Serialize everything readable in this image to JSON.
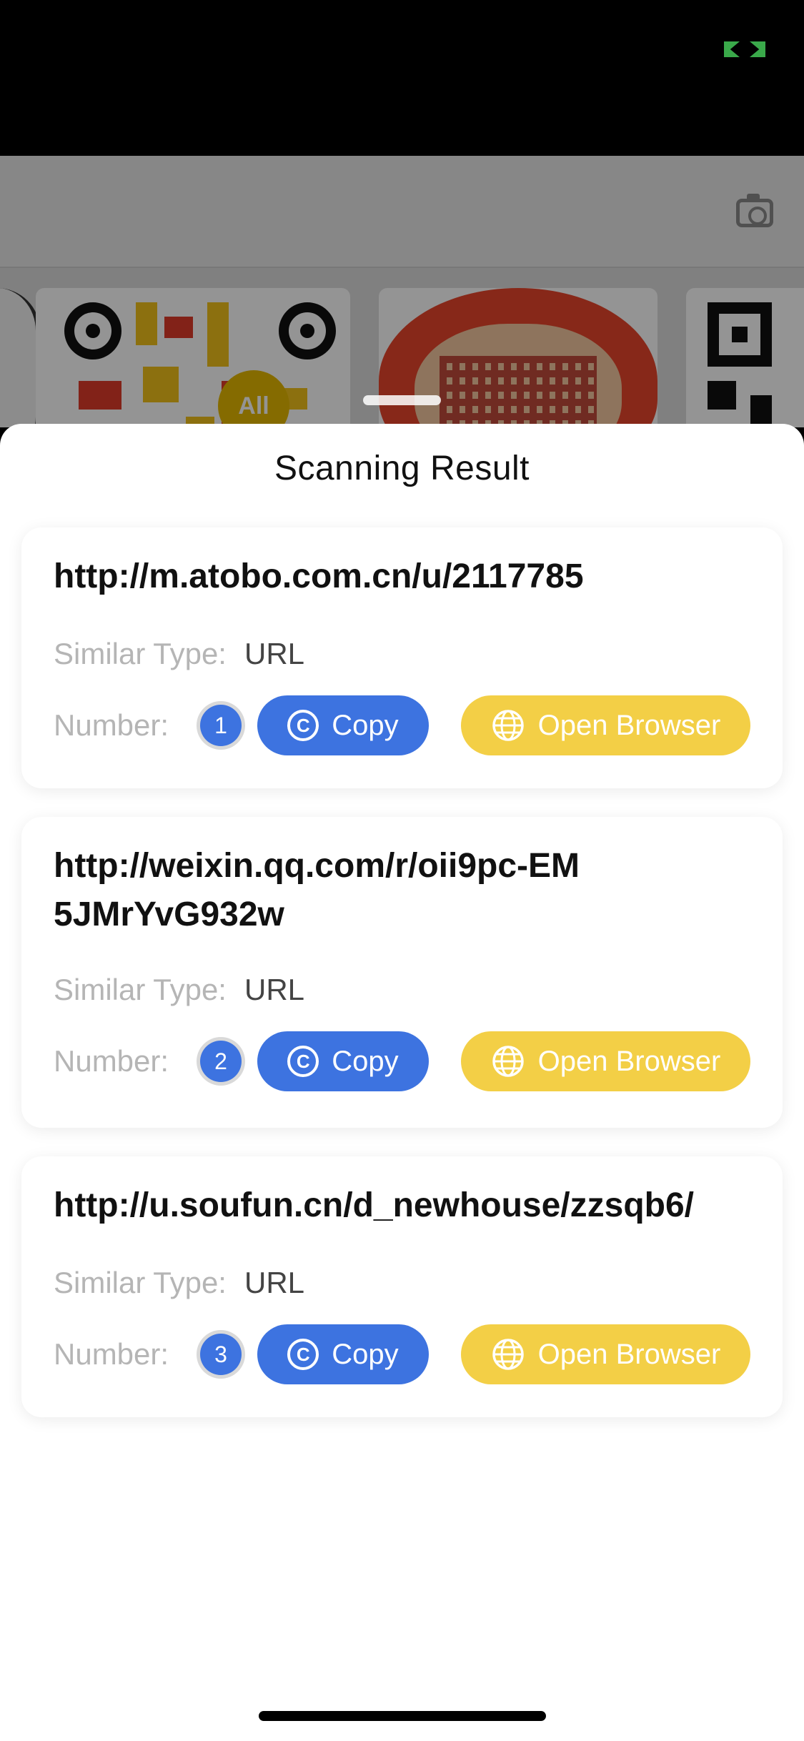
{
  "sheet": {
    "title": "Scanning Result"
  },
  "camera": {
    "all_chip_label": "All"
  },
  "results": [
    {
      "url": "http://m.atobo.com.cn/u/2117785",
      "type_label": "Similar Type:",
      "type_value": "URL",
      "number_label": "Number:",
      "number": "1",
      "copy_label": "Copy",
      "open_label": "Open Browser"
    },
    {
      "url": "http://weixin.qq.com/r/oii9pc-EM5JMrYvG932w",
      "type_label": "Similar Type:",
      "type_value": "URL",
      "number_label": "Number:",
      "number": "2",
      "copy_label": "Copy",
      "open_label": "Open Browser"
    },
    {
      "url": "http://u.soufun.cn/d_newhouse/zzsqb6/",
      "type_label": "Similar Type:",
      "type_value": "URL",
      "number_label": "Number:",
      "number": "3",
      "copy_label": "Copy",
      "open_label": "Open Browser"
    }
  ],
  "colors": {
    "copy_button": "#3d73e0",
    "open_button": "#f3cf46",
    "status_indicator": "#3aa94a"
  },
  "icons": {
    "copy": "copyright-c-icon",
    "open": "globe-icon",
    "camera": "camera-icon"
  }
}
